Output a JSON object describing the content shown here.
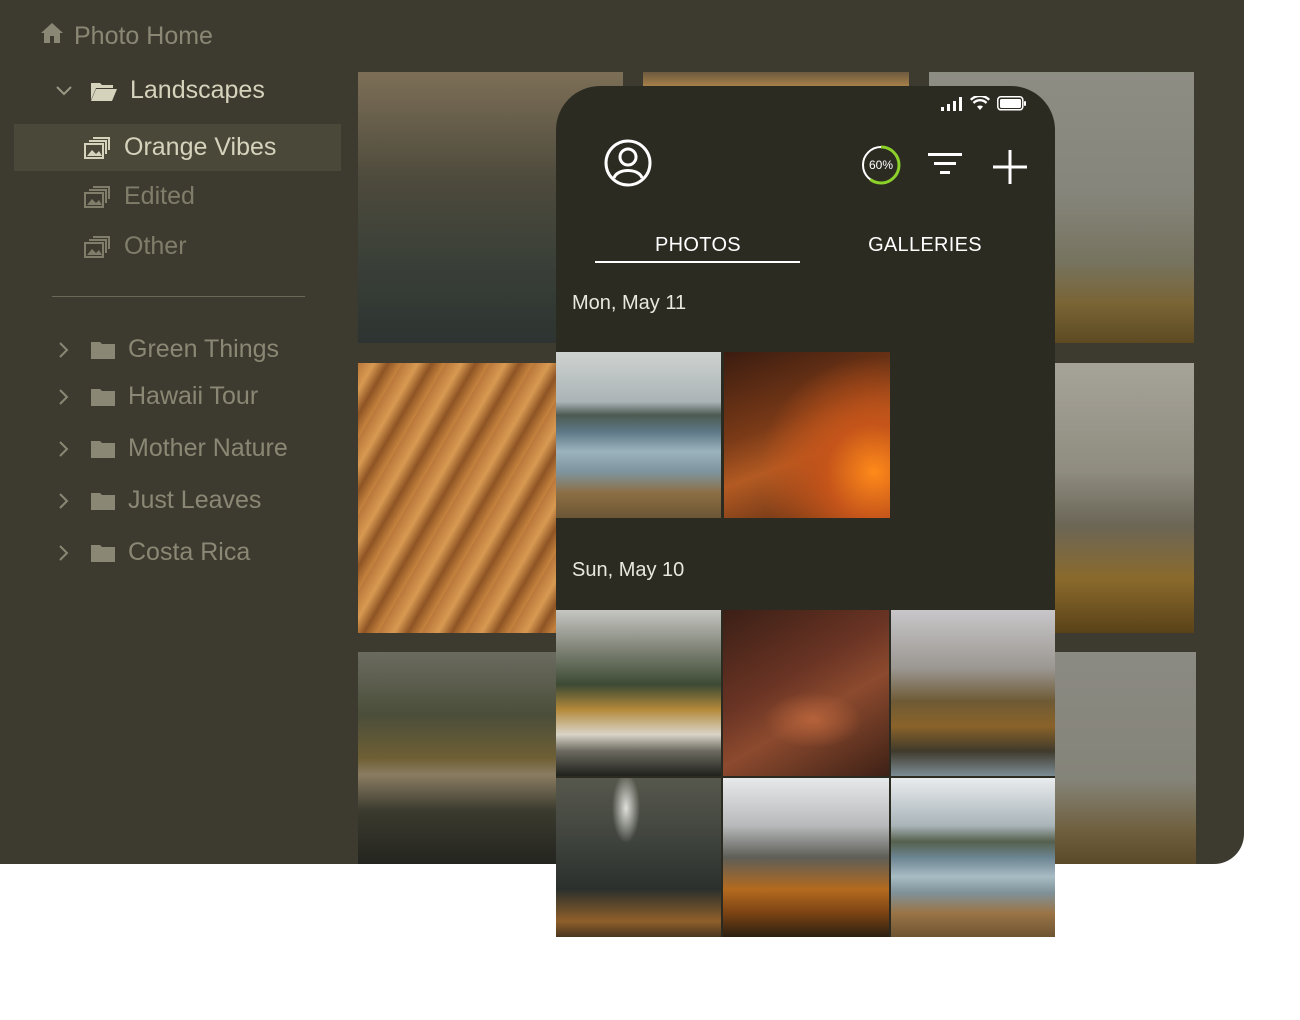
{
  "sidebar": {
    "home_label": "Photo Home",
    "current_folder": "Landscapes",
    "galleries": [
      {
        "label": "Orange Vibes",
        "selected": true
      },
      {
        "label": "Edited",
        "selected": false
      },
      {
        "label": "Other",
        "selected": false
      }
    ],
    "folders": [
      {
        "label": "Green Things"
      },
      {
        "label": "Hawaii Tour"
      },
      {
        "label": "Mother Nature"
      },
      {
        "label": "Just Leaves"
      },
      {
        "label": "Costa Rica"
      }
    ]
  },
  "desktop_grid": {
    "tiles": [
      "waterfall",
      "sunset",
      "foggy-forest",
      "canyon",
      "misty-mountain",
      "forest-lake",
      "foggy-hills"
    ]
  },
  "phone": {
    "status_icons": [
      "signal-icon",
      "wifi-icon",
      "battery-icon"
    ],
    "storage_progress": {
      "value": 0.6,
      "label": "60%"
    },
    "tabs": [
      {
        "label": "PHOTOS",
        "active": true
      },
      {
        "label": "GALLERIES",
        "active": false
      }
    ],
    "sections": [
      {
        "date": "Mon, May 11",
        "photos": [
          "lake-reflection",
          "golden-grass"
        ]
      },
      {
        "date": "Sun, May 10",
        "photos": [
          "autumn-forest-lake",
          "driftwood",
          "foggy-valley",
          "waterfall",
          "snowy-peaks",
          "lake-reflection"
        ]
      }
    ]
  },
  "colors": {
    "desktop_bg": "#3d3b2f",
    "phone_bg": "#2c2b22",
    "progress_ring": "#8bd12a",
    "text_active": "#d6d3bd",
    "text_muted": "#8a8874"
  }
}
